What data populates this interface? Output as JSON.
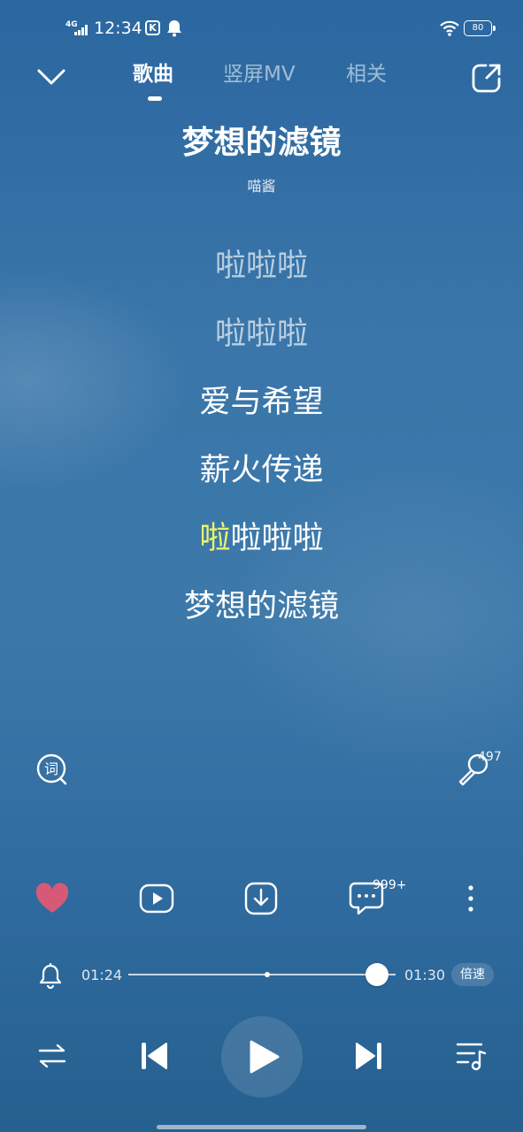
{
  "status_bar": {
    "network": "4G",
    "time": "12:34",
    "app_badge": "K",
    "battery": "80"
  },
  "header": {
    "tabs": [
      {
        "label": "歌曲",
        "active": true
      },
      {
        "label": "竖屏MV",
        "active": false
      },
      {
        "label": "相关",
        "active": false
      }
    ]
  },
  "song": {
    "title": "梦想的滤镜",
    "artist": "喵酱"
  },
  "lyrics": {
    "lines": [
      {
        "text": "啦啦啦",
        "state": "past"
      },
      {
        "text": "啦啦啦",
        "state": "past"
      },
      {
        "text": "爱与希望",
        "state": "upcoming"
      },
      {
        "text": "薪火传递",
        "state": "upcoming"
      },
      {
        "sung": "啦",
        "rest": "啦啦啦",
        "state": "current"
      },
      {
        "text": "梦想的滤镜",
        "state": "upcoming"
      }
    ],
    "highlight_color": "#ecf36a"
  },
  "tools": {
    "lyric_search_icon": "lyric-search-icon",
    "karaoke_count": "497"
  },
  "actions": {
    "like_color": "#d65a78",
    "comment_count": "999+"
  },
  "progress": {
    "current": "01:24",
    "total": "01:30",
    "fraction": 0.93,
    "marker_fraction": 0.52,
    "speed_label": "倍速"
  },
  "colors": {
    "background_top": "#2b67a0",
    "background_bottom": "#25608f"
  }
}
